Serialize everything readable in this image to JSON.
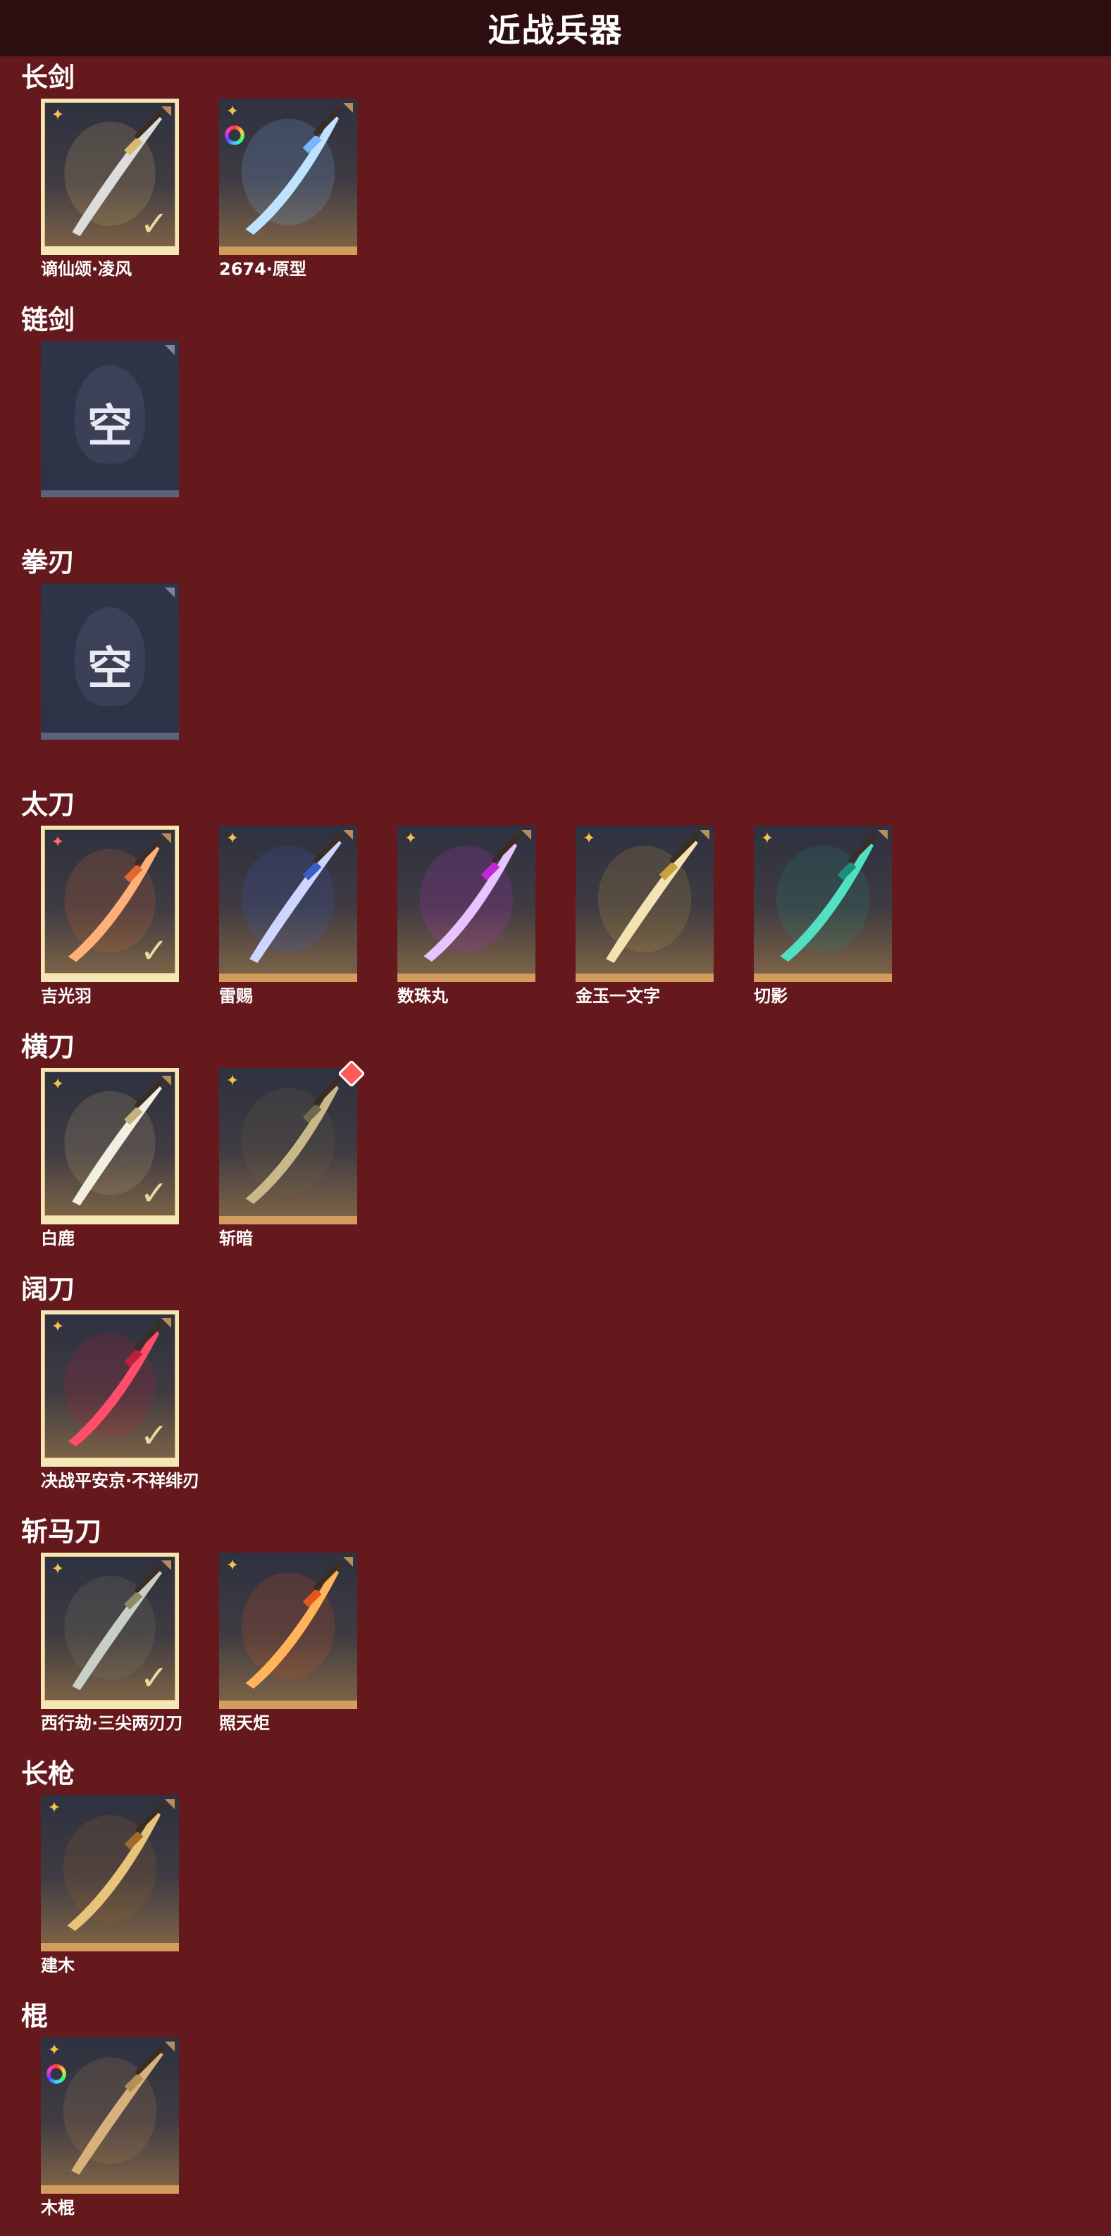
{
  "header": {
    "title": "近战兵器"
  },
  "colors": {
    "background": "#65191d",
    "header": "#2d0f12",
    "card_border": "#d29c5e",
    "selected_frame": "#f5e6b6"
  },
  "categories": [
    {
      "title": "长剑",
      "items": [
        {
          "name": "谪仙颂·凌风",
          "selected": true,
          "rarity_icon": "gold-star-icon",
          "blade_color": "#dcdcdc",
          "accent": "#d9b870"
        },
        {
          "name": "2674·原型",
          "selected": false,
          "rarity_icon": "gold-star-icon",
          "skin_icon": "rainbow-ring-icon",
          "blade_color": "#bfe3ff",
          "accent": "#7ab6ff"
        }
      ]
    },
    {
      "title": "链剑",
      "items": [
        {
          "empty": true,
          "glyph": "空"
        }
      ]
    },
    {
      "title": "拳刃",
      "items": [
        {
          "empty": true,
          "glyph": "空"
        }
      ]
    },
    {
      "title": "太刀",
      "items": [
        {
          "name": "吉光羽",
          "selected": true,
          "rarity_icon": "red-star-icon",
          "blade_color": "#ffb07a",
          "accent": "#e0672e"
        },
        {
          "name": "雷赐",
          "selected": false,
          "rarity_icon": "gold-star-icon",
          "blade_color": "#cdd6ff",
          "accent": "#3a5dc9"
        },
        {
          "name": "数珠丸",
          "selected": false,
          "rarity_icon": "gold-star-icon",
          "blade_color": "#e7c4ff",
          "accent": "#c02ad6"
        },
        {
          "name": "金玉一文字",
          "selected": false,
          "rarity_icon": "gold-star-icon",
          "blade_color": "#f4e3b2",
          "accent": "#c9a23e"
        },
        {
          "name": "切影",
          "selected": false,
          "rarity_icon": "gold-star-icon",
          "blade_color": "#52e0c2",
          "accent": "#1b8f7b"
        }
      ]
    },
    {
      "title": "横刀",
      "items": [
        {
          "name": "白鹿",
          "selected": true,
          "rarity_icon": "gold-star-icon",
          "blade_color": "#f2eee0",
          "accent": "#c9b27a"
        },
        {
          "name": "斩暗",
          "selected": false,
          "rarity_icon": "gold-star-icon",
          "badge_icon": "red-plus-badge-icon",
          "blade_color": "#c9b98a",
          "accent": "#6f6a4a"
        }
      ]
    },
    {
      "title": "阔刀",
      "items": [
        {
          "name": "决战平安京·不祥绯刃",
          "selected": true,
          "rarity_icon": "gold-star-icon",
          "blade_color": "#ff4d6a",
          "accent": "#c01e3a"
        }
      ]
    },
    {
      "title": "斩马刀",
      "items": [
        {
          "name": "西行劫·三尖两刃刀",
          "selected": true,
          "rarity_icon": "gold-star-icon",
          "blade_color": "#c8cfc5",
          "accent": "#8d8a6a"
        },
        {
          "name": "照天炬",
          "selected": false,
          "rarity_icon": "gold-star-icon",
          "blade_color": "#ffb35a",
          "accent": "#e2551d"
        }
      ]
    },
    {
      "title": "长枪",
      "items": [
        {
          "name": "建木",
          "selected": false,
          "rarity_icon": "gold-star-icon",
          "blade_color": "#e8c47a",
          "accent": "#9e6a2d"
        }
      ]
    },
    {
      "title": "棍",
      "items": [
        {
          "name": "木棍",
          "selected": false,
          "rarity_icon": "gold-star-icon",
          "skin_icon": "rainbow-ring-icon",
          "blade_color": "#d7b07a",
          "accent": "#b58d55"
        }
      ]
    }
  ]
}
